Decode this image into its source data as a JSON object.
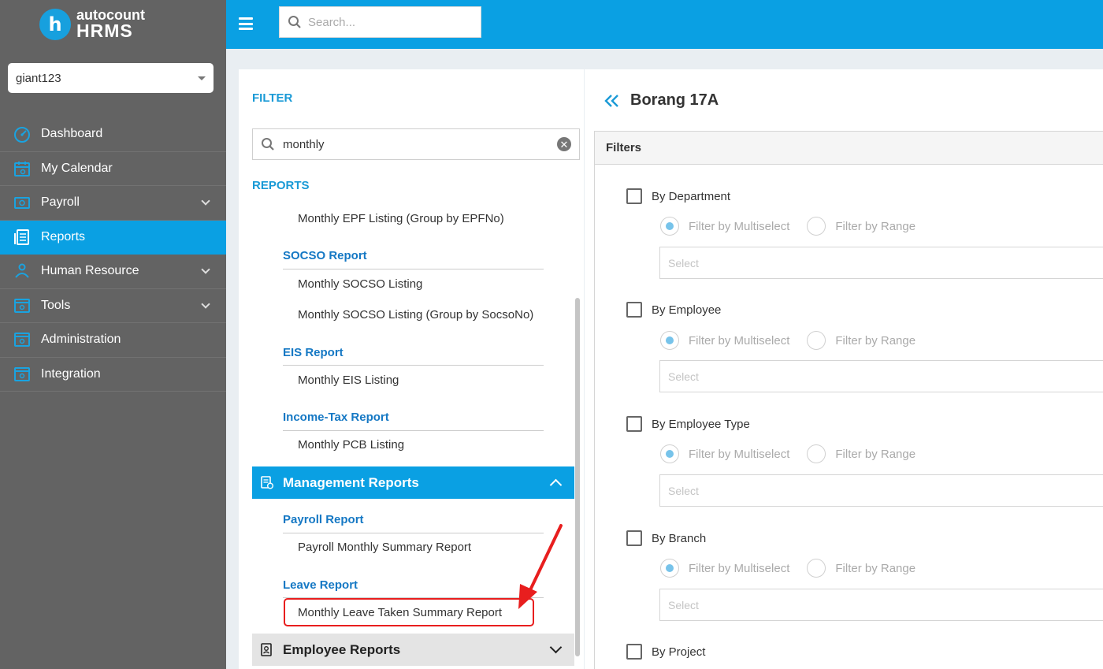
{
  "brand": {
    "logo_letter": "h",
    "name_top": "autocount",
    "name_bottom": "HRMS"
  },
  "company_select": {
    "value": "giant123"
  },
  "nav": {
    "items": [
      {
        "label": "Dashboard"
      },
      {
        "label": "My Calendar"
      },
      {
        "label": "Payroll"
      },
      {
        "label": "Reports"
      },
      {
        "label": "Human Resource"
      },
      {
        "label": "Tools"
      },
      {
        "label": "Administration"
      },
      {
        "label": "Integration"
      }
    ]
  },
  "topbar": {
    "search_placeholder": "Search..."
  },
  "filter_panel": {
    "filter_heading": "FILTER",
    "search_value": "monthly",
    "clear_symbol": "✕",
    "reports_heading": "REPORTS",
    "items": {
      "epf_group_listing": "Monthly EPF Listing (Group by EPFNo)",
      "socso_group": "SOCSO Report",
      "socso_listing": "Monthly SOCSO Listing",
      "socso_group_listing": "Monthly SOCSO Listing (Group by SocsoNo)",
      "eis_group": "EIS Report",
      "eis_listing": "Monthly EIS Listing",
      "tax_group": "Income-Tax Report",
      "pcb_listing": "Monthly PCB Listing",
      "payroll_group": "Payroll Report",
      "payroll_summary": "Payroll Monthly Summary Report",
      "leave_group": "Leave Report",
      "leave_summary": "Monthly Leave Taken Summary Report"
    },
    "sections": {
      "management": "Management Reports",
      "employee": "Employee Reports"
    }
  },
  "main": {
    "title": "Borang 17A",
    "filters_title": "Filters",
    "radio_multiselect": "Filter by Multiselect",
    "radio_range": "Filter by Range",
    "select_placeholder": "Select",
    "groups": [
      {
        "label": "By Department"
      },
      {
        "label": "By Employee"
      },
      {
        "label": "By Employee Type"
      },
      {
        "label": "By Branch"
      },
      {
        "label": "By Project"
      }
    ]
  },
  "colors": {
    "accent": "#0aa0e3",
    "sidebar": "#636363",
    "highlight": "#e81e1e"
  }
}
